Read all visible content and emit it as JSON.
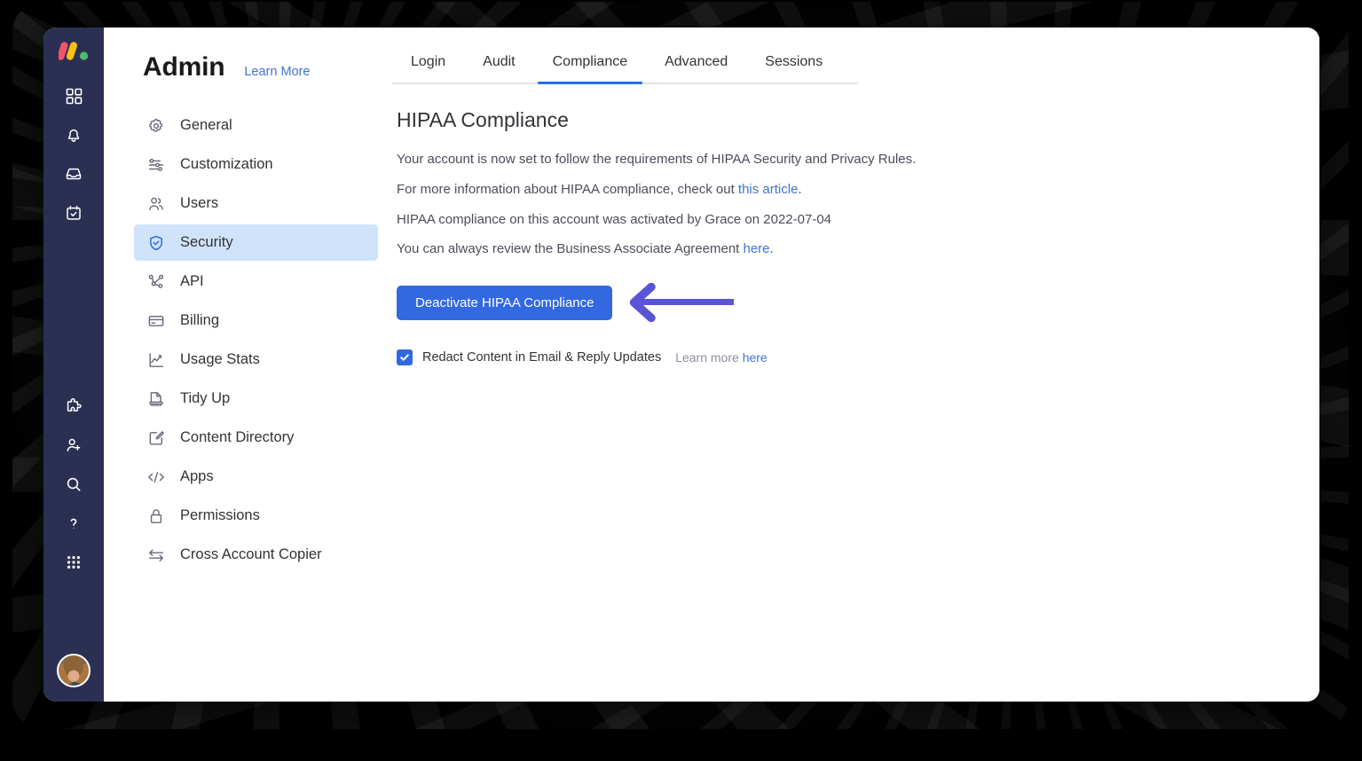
{
  "rail": {
    "logo": "monday-logo",
    "items": [
      {
        "name": "home-grid-icon",
        "label": "Home"
      },
      {
        "name": "notifications-bell-icon",
        "label": "Notifications"
      },
      {
        "name": "inbox-icon",
        "label": "Inbox"
      },
      {
        "name": "my-work-calendar-icon",
        "label": "My Work"
      },
      {
        "name": "apps-puzzle-icon",
        "label": "Apps"
      },
      {
        "name": "invite-member-icon",
        "label": "Invite Members"
      },
      {
        "name": "search-icon",
        "label": "Search"
      },
      {
        "name": "help-question-icon",
        "label": "Help"
      },
      {
        "name": "products-dots-icon",
        "label": "Products"
      }
    ],
    "avatar_alt": "User avatar"
  },
  "nav": {
    "title": "Admin",
    "learn_more": "Learn More",
    "items": [
      {
        "label": "General",
        "icon": "gear-icon",
        "active": false
      },
      {
        "label": "Customization",
        "icon": "sliders-icon",
        "active": false
      },
      {
        "label": "Users",
        "icon": "users-icon",
        "active": false
      },
      {
        "label": "Security",
        "icon": "shield-check-icon",
        "active": true
      },
      {
        "label": "API",
        "icon": "api-nodes-icon",
        "active": false
      },
      {
        "label": "Billing",
        "icon": "credit-card-icon",
        "active": false
      },
      {
        "label": "Usage Stats",
        "icon": "chart-line-icon",
        "active": false
      },
      {
        "label": "Tidy Up",
        "icon": "tidy-up-icon",
        "active": false
      },
      {
        "label": "Content Directory",
        "icon": "content-directory-icon",
        "active": false
      },
      {
        "label": "Apps",
        "icon": "code-brackets-icon",
        "active": false
      },
      {
        "label": "Permissions",
        "icon": "lock-icon",
        "active": false
      },
      {
        "label": "Cross Account Copier",
        "icon": "transfer-arrows-icon",
        "active": false
      }
    ]
  },
  "tabs": [
    {
      "label": "Login",
      "active": false
    },
    {
      "label": "Audit",
      "active": false
    },
    {
      "label": "Compliance",
      "active": true
    },
    {
      "label": "Advanced",
      "active": false
    },
    {
      "label": "Sessions",
      "active": false
    }
  ],
  "content": {
    "heading": "HIPAA Compliance",
    "line1": "Your account is now set to follow the requirements of HIPAA Security and Privacy Rules.",
    "line2_pre": "For more information about HIPAA compliance, check out ",
    "line2_link": "this article",
    "line2_post": ".",
    "line3": "HIPAA compliance on this account was activated by Grace on 2022-07-04",
    "line4_pre": "You can always review the Business Associate Agreement ",
    "line4_link": "here",
    "line4_post": ".",
    "deactivate_button": "Deactivate HIPAA Compliance",
    "redact_label": "Redact Content in Email & Reply Updates",
    "redact_hint": "Learn more",
    "redact_hint_link": "here",
    "redact_checked": true
  },
  "colors": {
    "rail_bg": "#2b3053",
    "primary_blue": "#3268e0",
    "link_blue": "#3f74d4",
    "active_nav_bg": "#cfe3fb",
    "active_nav_icon": "#2f6fd0",
    "tab_underline": "#2570e8",
    "annotation_arrow": "#5a55d6",
    "logo_red": "#f4546a",
    "logo_yellow": "#fcc113",
    "logo_green": "#4bbd6d"
  }
}
